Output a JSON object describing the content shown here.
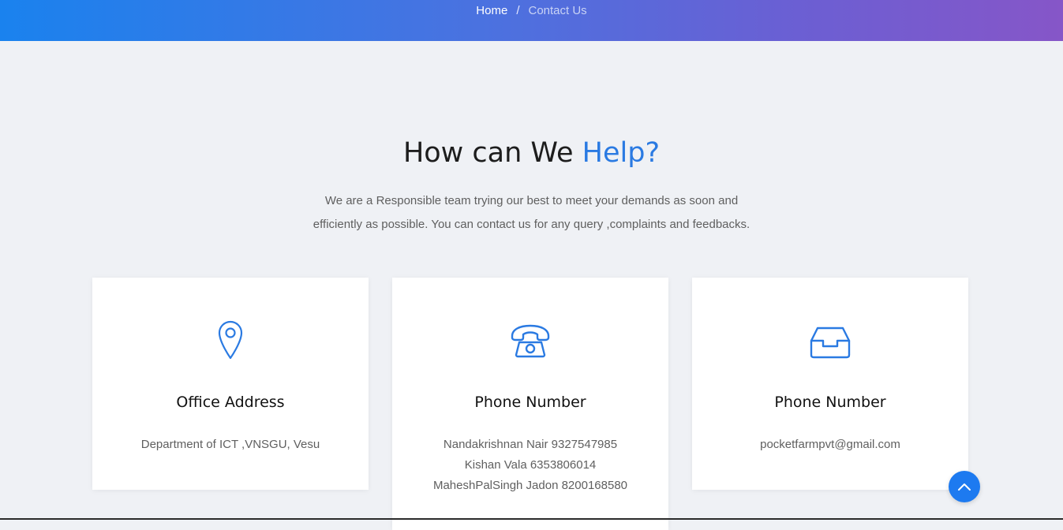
{
  "breadcrumb": {
    "home": "Home",
    "separator": "/",
    "current": "Contact Us"
  },
  "heading": {
    "prefix": "How can We ",
    "accent": "Help?"
  },
  "intro": {
    "line1": "We are a Responsible team trying our best to meet your demands as soon and",
    "line2": "efficiently as possible. You can contact us for any query ,complaints and feedbacks."
  },
  "cards": [
    {
      "icon": "location-pin-icon",
      "title": "Office Address",
      "lines": [
        "Department of ICT ,VNSGU, Vesu"
      ]
    },
    {
      "icon": "telephone-icon",
      "title": "Phone Number",
      "lines": [
        "Nandakrishnan Nair 9327547985",
        "Kishan Vala 6353806014",
        "MaheshPalSingh Jadon 8200168580"
      ]
    },
    {
      "icon": "inbox-icon",
      "title": "Phone Number",
      "lines": [
        "pocketfarmpvt@gmail.com"
      ]
    }
  ],
  "back_to_top": {
    "icon": "chevron-up-icon"
  },
  "colors": {
    "accent": "#2a7ae2",
    "hero_start": "#1a82ee",
    "hero_end": "#8656c8",
    "page_bg": "#eff1f5",
    "button": "#1d7af0"
  }
}
